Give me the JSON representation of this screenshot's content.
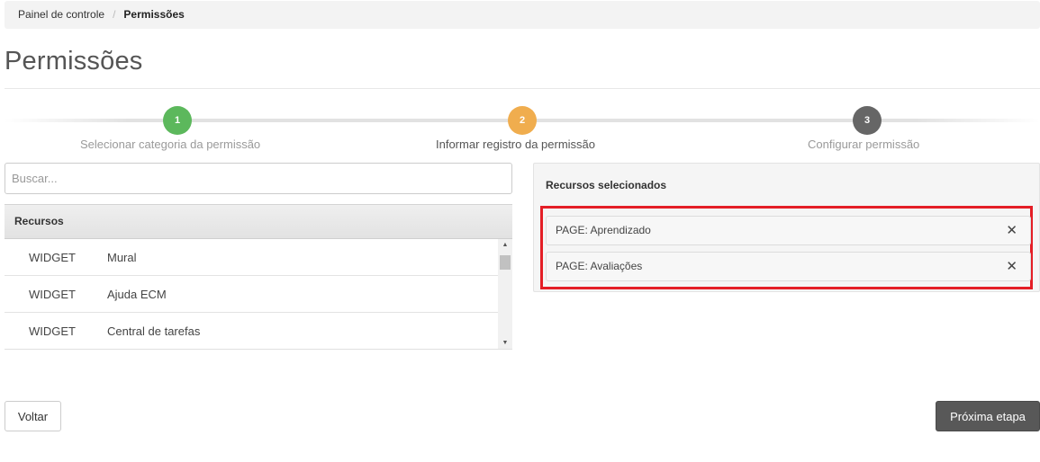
{
  "breadcrumb": {
    "home": "Painel de controle",
    "separator": "/",
    "current": "Permissões"
  },
  "page": {
    "title": "Permissões"
  },
  "stepper": {
    "steps": [
      {
        "number": "1",
        "label": "Selecionar categoria da permissão",
        "state": "completed",
        "color": "#5cb85c"
      },
      {
        "number": "2",
        "label": "Informar registro da permissão",
        "state": "active",
        "color": "#f0ad4e"
      },
      {
        "number": "3",
        "label": "Configurar permissão",
        "state": "pending",
        "color": "#666666"
      }
    ]
  },
  "search": {
    "placeholder": "Buscar...",
    "value": ""
  },
  "resources": {
    "header": "Recursos",
    "rows": [
      {
        "type": "WIDGET",
        "name": "Mural"
      },
      {
        "type": "WIDGET",
        "name": "Ajuda ECM"
      },
      {
        "type": "WIDGET",
        "name": "Central de tarefas"
      }
    ]
  },
  "selected": {
    "title": "Recursos selecionados",
    "items": [
      {
        "label": "PAGE: Aprendizado",
        "remove_icon": "✕"
      },
      {
        "label": "PAGE: Avaliações",
        "remove_icon": "✕"
      }
    ],
    "highlight_color": "#e41e26"
  },
  "actions": {
    "back_label": "Voltar",
    "next_label": "Próxima etapa"
  }
}
